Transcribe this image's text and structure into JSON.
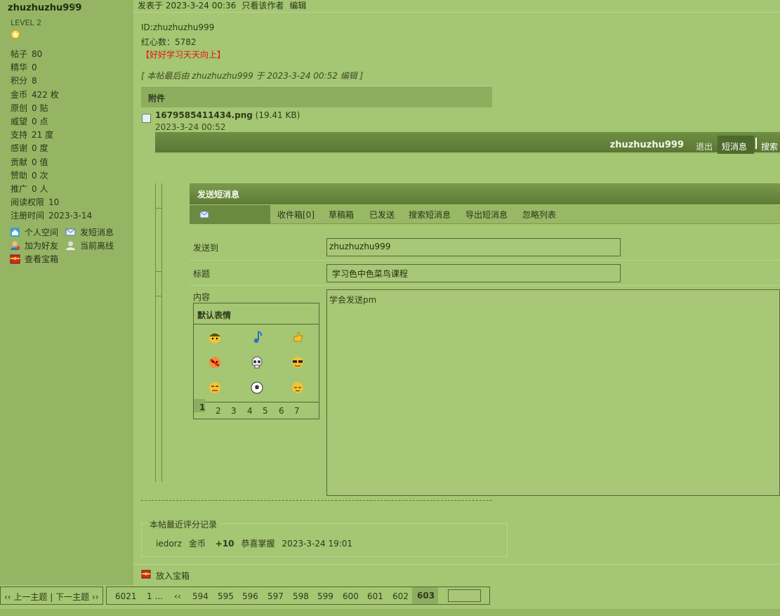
{
  "sidebar": {
    "username": "zhuzhuzhu999",
    "level": "LEVEL 2",
    "stats": [
      {
        "k": "帖子",
        "v": "80"
      },
      {
        "k": "精华",
        "v": "0"
      },
      {
        "k": "积分",
        "v": "8"
      },
      {
        "k": "金币",
        "v": "422 枚"
      },
      {
        "k": "原创",
        "v": "0 贴"
      },
      {
        "k": "威望",
        "v": "0 点"
      },
      {
        "k": "支持",
        "v": "21 度"
      },
      {
        "k": "感谢",
        "v": "0 度"
      },
      {
        "k": "贡献",
        "v": "0 值"
      },
      {
        "k": "赞助",
        "v": "0 次"
      },
      {
        "k": "推广",
        "v": "0 人"
      },
      {
        "k": "阅读权限",
        "v": "10"
      },
      {
        "k": "注册时间",
        "v": "2023-3-14"
      }
    ],
    "links": {
      "space": "个人空间",
      "send_pm": "发短消息",
      "add_friend": "加为好友",
      "offline": "当前离线",
      "treasure": "查看宝箱"
    }
  },
  "post": {
    "posted_at": "发表于 2023-3-24 00:36",
    "only_author": "只看该作者",
    "edit": "编辑",
    "sig_id": "ID:zhuzhuzhu999",
    "sig_hearts": "红心数：5782",
    "sig_motto": "【好好学习天天向上】",
    "edit_note": "[ 本帖最后由 zhuzhuzhu999 于 2023-3-24 00:52 编辑 ]",
    "attachment_header": "附件",
    "file_name": "1679585411434.png",
    "file_size": "(19.41 KB)",
    "file_date": "2023-3-24 00:52"
  },
  "topbar": {
    "user": "zhuzhuzhu999",
    "logout": "退出",
    "pm": "短消息",
    "search": "搜索"
  },
  "pm": {
    "title": "发送短消息",
    "tabs": [
      "收件箱[0]",
      "草稿箱",
      "已发送",
      "搜索短消息",
      "导出短消息",
      "忽略列表"
    ],
    "to_label": "发送到",
    "to_value": "zhuzhuzhu999",
    "subject_label": "标题",
    "subject_value": " 学习色中色菜鸟课程",
    "content_label": "内容",
    "content_value": "学会发送pm",
    "smilies_title": "默认表情",
    "smiley_pages": [
      "1",
      "2",
      "3",
      "4",
      "5",
      "6",
      "7"
    ]
  },
  "rating": {
    "legend": "本帖最近评分记录",
    "user": "iedorz",
    "currency": "金币",
    "amount": "+10",
    "reason": "恭喜掌握",
    "time": "2023-3-24 19:01"
  },
  "footer": {
    "treasure": "放入宝箱",
    "prevnext": "‹‹ 上一主题 | 下一主题 ››",
    "pages": [
      "6021",
      "1 ...",
      "‹‹",
      "594",
      "595",
      "596",
      "597",
      "598",
      "599",
      "600",
      "601",
      "602"
    ],
    "current_page": "603"
  }
}
